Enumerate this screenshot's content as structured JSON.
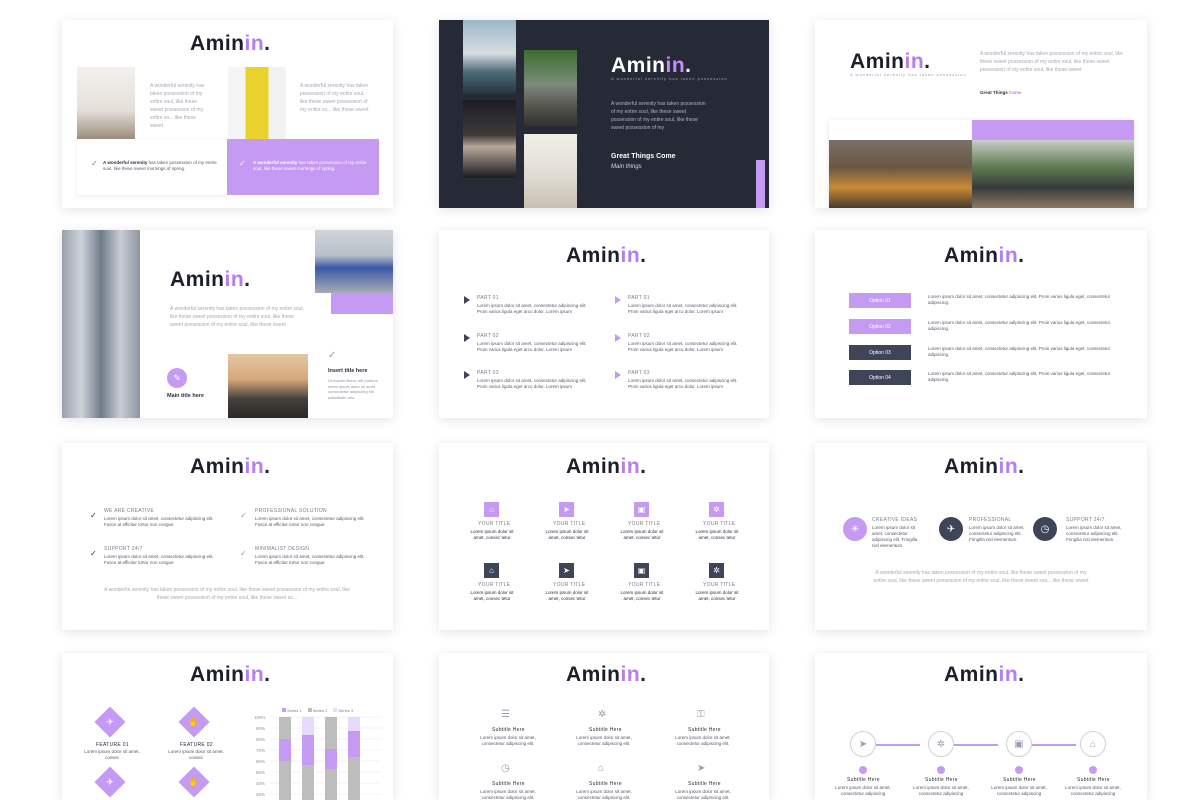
{
  "brand": {
    "name_a": "Amin",
    "name_b": "in",
    "dot": ".",
    "accent": "#c59af3",
    "navy": "#3f4559",
    "dark_bg": "#262a37"
  },
  "s1": {
    "para": "A wonderful serenity has taken possession of my entire soul, like these sweet possession of my entire so... like these sweet",
    "bar_left_bold": "A wonderful serenity",
    "bar_left_text": "has taken possession of my entire soul, like these sweet mornings of spring.",
    "bar_right_bold": "A wonderful serenity",
    "bar_right_text": "has taken possession of my entire soul, like these sweet mornings of spring."
  },
  "s2": {
    "tagline": "A wonderful serenity has taken possession",
    "para": "A wonderful serenity has taken possession of my entire soul, like these sweet possession of my entire soul, like these sweet possession of my",
    "heading": "Great Things Come",
    "subheading": "Main things"
  },
  "s3": {
    "tagline": "A wonderful serenity has taken possession",
    "para": "A wonderful serenity has taken possession of my entire soul, like these sweet possession of my entire soul, like these sweet possession of my entire soul, like these sweet",
    "link_a": "Great Things",
    "link_b": "Come"
  },
  "s4": {
    "para": "A wonderful serenity has taken possession of my entire soul, like these sweet possession of my entire soul, like these sweet possession of my entire soul, like these sweet",
    "main_title": "Main title here",
    "insert_title": "Insert title here",
    "insert_text": "Ut mauris libero, elit pretium lorem ipsum dolor sit amet consectetur adipiscing elit sollicitudin nec."
  },
  "s5": {
    "items": [
      {
        "title": "PART 01",
        "text": "Lorem ipsum dolor sit amet, consectetur adipiscing elit. Proin varius ligula eget arcu dolor. Lorem ipsum"
      },
      {
        "title": "PART 01",
        "text": "Lorem ipsum dolor sit amet, consectetur adipiscing elit. Proin varius ligula eget arcu dolor. Lorem ipsum"
      },
      {
        "title": "PART 02",
        "text": "Lorem ipsum dolor sit amet, consectetur adipiscing elit. Proin varius ligula eget arcu dolor. Lorem ipsum"
      },
      {
        "title": "PART 02",
        "text": "Lorem ipsum dolor sit amet, consectetur adipiscing elit. Proin varius ligula eget arcu dolor. Lorem ipsum"
      },
      {
        "title": "PART 03",
        "text": "Lorem ipsum dolor sit amet, consectetur adipiscing elit. Proin varius ligula eget arcu dolor. Lorem ipsum"
      },
      {
        "title": "PART 03",
        "text": "Lorem ipsum dolor sit amet, consectetur adipiscing elit. Proin varius ligula eget arcu dolor. Lorem ipsum"
      }
    ]
  },
  "s6": {
    "options": [
      {
        "label": "Option 01",
        "text": "Lorem ipsum dolor sit amet, consectetur adipiscing elit. Proin varius ligula eget, consectetur adipiscing."
      },
      {
        "label": "Option 02",
        "text": "Lorem ipsum dolor sit amet, consectetur adipiscing elit. Proin varius ligula eget, consectetur adipiscing."
      },
      {
        "label": "Option 03",
        "text": "Lorem ipsum dolor sit amet, consectetur adipiscing elit. Proin varius ligula eget, consectetur adipiscing."
      },
      {
        "label": "Option 04",
        "text": "Lorem ipsum dolor sit amet, consectetur adipiscing elit. Proin varius ligula eget, consectetur adipiscing."
      }
    ]
  },
  "s7": {
    "items": [
      {
        "title": "WE ARE CREATIVE",
        "text": "Lorem ipsum dolor sit amet, consectetur adipiscing elit. Fusce at efficitur tortor non congue"
      },
      {
        "title": "PROFESSIONAL SOLUTION",
        "text": "Lorem ipsum dolor sit amet, consectetur adipiscing elit. Fusce at efficitur tortor non congue"
      },
      {
        "title": "SUPPORT 24/7",
        "text": "Lorem ipsum dolor sit amet, consectetur adipiscing elit. Fusce at efficitur tortor non congue"
      },
      {
        "title": "MINIMALIST DESIGN",
        "text": "Lorem ipsum dolor sit amet, consectetur adipiscing elit. Fusce at efficitur tortor non congue"
      }
    ],
    "para": "A wonderful serenity has taken possession of my entire soul, like these sweet possession of my entire soul, like these sweet possession of my entire soul, like these sweet so..."
  },
  "s8": {
    "item_title": "YOUR TITLE",
    "item_text": "Lorem ipsum dolor sit amet, consec tetur"
  },
  "s9": {
    "items": [
      {
        "title": "CREATIVE IDEAS",
        "text": "Lorem ipsum dolor sit amet, consectetur adipiscing elit. Fringilla nisl elementum."
      },
      {
        "title": "PROFESSIONAL",
        "text": "Lorem ipsum dolor sit amet, consectetur adipiscing elit. Fringilla nisl elementum."
      },
      {
        "title": "SUPPORT 24/7",
        "text": "Lorem ipsum dolor sit amet, consectetur adipiscing elit. Fringilla nisl elementum."
      }
    ],
    "para": "A wonderful serenity has taken possession of my entire soul, like these sweet possession of my entire soul, like these sweet possession of my entire soul, like these sweet sou... like these sweet"
  },
  "s10": {
    "features": [
      {
        "title": "FEATURE 01",
        "text": "Lorem ipsum dolor sit amet, consec"
      },
      {
        "title": "FEATURE 02",
        "text": "Lorem ipsum dolor sit amet, consec"
      }
    ],
    "chart_data": {
      "type": "bar",
      "stacked": true,
      "legend_position": "top",
      "series": [
        {
          "name": "Series 1",
          "color": "#c59af3"
        },
        {
          "name": "Series 2",
          "color": "#bdbdbd"
        },
        {
          "name": "Series 3",
          "color": "#e9d9fb"
        }
      ],
      "y_ticks": [
        "100%",
        "90%",
        "80%",
        "70%",
        "60%",
        "50%",
        "40%",
        "30%"
      ]
    }
  },
  "s11": {
    "item_title": "Subtitle Here",
    "item_text": "Lorem ipsum dolor sit amet, consectetur adipiscing elit."
  },
  "s12": {
    "item_title": "Subtitle Here",
    "item_text": "Lorem ipsum dolor sit amet, consectetur adipiscing"
  }
}
